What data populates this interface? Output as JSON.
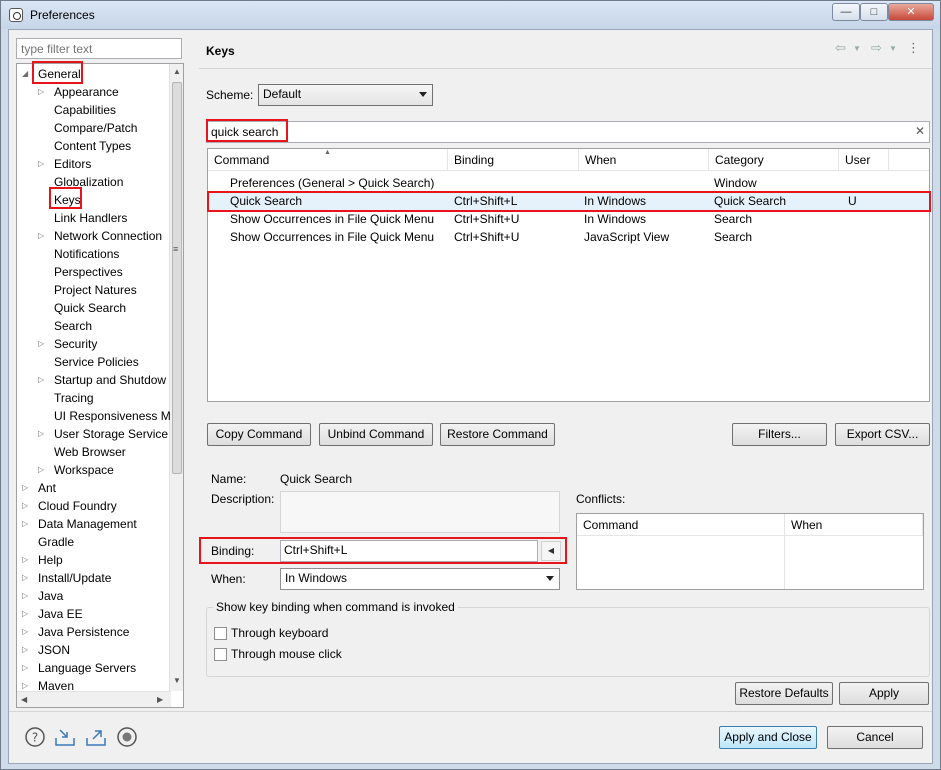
{
  "window": {
    "title": "Preferences",
    "controls": {
      "minimize": "—",
      "maximize": "□",
      "close": "✕"
    }
  },
  "sidebar": {
    "filter_placeholder": "type filter text",
    "items": [
      {
        "label": "General",
        "level": 0,
        "expander": "expanded"
      },
      {
        "label": "Appearance",
        "level": 1,
        "expander": "collapsed"
      },
      {
        "label": "Capabilities",
        "level": 1,
        "expander": "none"
      },
      {
        "label": "Compare/Patch",
        "level": 1,
        "expander": "none"
      },
      {
        "label": "Content Types",
        "level": 1,
        "expander": "none"
      },
      {
        "label": "Editors",
        "level": 1,
        "expander": "collapsed"
      },
      {
        "label": "Globalization",
        "level": 1,
        "expander": "none"
      },
      {
        "label": "Keys",
        "level": 1,
        "expander": "none"
      },
      {
        "label": "Link Handlers",
        "level": 1,
        "expander": "none"
      },
      {
        "label": "Network Connection",
        "level": 1,
        "expander": "collapsed"
      },
      {
        "label": "Notifications",
        "level": 1,
        "expander": "none"
      },
      {
        "label": "Perspectives",
        "level": 1,
        "expander": "none"
      },
      {
        "label": "Project Natures",
        "level": 1,
        "expander": "none"
      },
      {
        "label": "Quick Search",
        "level": 1,
        "expander": "none"
      },
      {
        "label": "Search",
        "level": 1,
        "expander": "none"
      },
      {
        "label": "Security",
        "level": 1,
        "expander": "collapsed"
      },
      {
        "label": "Service Policies",
        "level": 1,
        "expander": "none"
      },
      {
        "label": "Startup and Shutdow",
        "level": 1,
        "expander": "collapsed"
      },
      {
        "label": "Tracing",
        "level": 1,
        "expander": "none"
      },
      {
        "label": "UI Responsiveness M",
        "level": 1,
        "expander": "none"
      },
      {
        "label": "User Storage Service",
        "level": 1,
        "expander": "collapsed"
      },
      {
        "label": "Web Browser",
        "level": 1,
        "expander": "none"
      },
      {
        "label": "Workspace",
        "level": 1,
        "expander": "collapsed"
      },
      {
        "label": "Ant",
        "level": 0,
        "expander": "collapsed"
      },
      {
        "label": "Cloud Foundry",
        "level": 0,
        "expander": "collapsed"
      },
      {
        "label": "Data Management",
        "level": 0,
        "expander": "collapsed"
      },
      {
        "label": "Gradle",
        "level": 0,
        "expander": "none"
      },
      {
        "label": "Help",
        "level": 0,
        "expander": "collapsed"
      },
      {
        "label": "Install/Update",
        "level": 0,
        "expander": "collapsed"
      },
      {
        "label": "Java",
        "level": 0,
        "expander": "collapsed"
      },
      {
        "label": "Java EE",
        "level": 0,
        "expander": "collapsed"
      },
      {
        "label": "Java Persistence",
        "level": 0,
        "expander": "collapsed"
      },
      {
        "label": "JSON",
        "level": 0,
        "expander": "collapsed"
      },
      {
        "label": "Language Servers",
        "level": 0,
        "expander": "collapsed"
      },
      {
        "label": "Maven",
        "level": 0,
        "expander": "collapsed"
      }
    ]
  },
  "page": {
    "title": "Keys",
    "scheme_label": "Scheme:",
    "scheme_value": "Default",
    "search_value": "quick search",
    "search_clear": "✕",
    "table": {
      "columns": [
        "Command",
        "Binding",
        "When",
        "Category",
        "User"
      ],
      "rows": [
        [
          "Preferences (General > Quick Search)",
          "",
          "",
          "Window",
          ""
        ],
        [
          "Quick Search",
          "Ctrl+Shift+L",
          "In Windows",
          "Quick Search",
          "U"
        ],
        [
          "Show Occurrences in File Quick Menu",
          "Ctrl+Shift+U",
          "In Windows",
          "Search",
          ""
        ],
        [
          "Show Occurrences in File Quick Menu",
          "Ctrl+Shift+U",
          "JavaScript View",
          "Search",
          ""
        ]
      ]
    },
    "buttons": {
      "copy_command": "Copy Command",
      "unbind_command": "Unbind Command",
      "restore_command": "Restore Command",
      "filters": "Filters...",
      "export_csv": "Export CSV..."
    },
    "details": {
      "name_label": "Name:",
      "name_value": "Quick Search",
      "description_label": "Description:",
      "binding_label": "Binding:",
      "binding_value": "Ctrl+Shift+L",
      "when_label": "When:",
      "when_value": "In Windows"
    },
    "conflicts": {
      "label": "Conflicts:",
      "columns": [
        "Command",
        "When"
      ]
    },
    "show_binding_group": {
      "title": "Show key binding when command is invoked",
      "through_keyboard": "Through keyboard",
      "through_mouse": "Through mouse click"
    },
    "restore_defaults": "Restore Defaults",
    "apply": "Apply"
  },
  "footer": {
    "apply_and_close": "Apply and Close",
    "cancel": "Cancel"
  },
  "colors": {
    "highlight": "#e8141c",
    "selection": "#e5f1fb",
    "default_button": "#3c7fb1"
  }
}
